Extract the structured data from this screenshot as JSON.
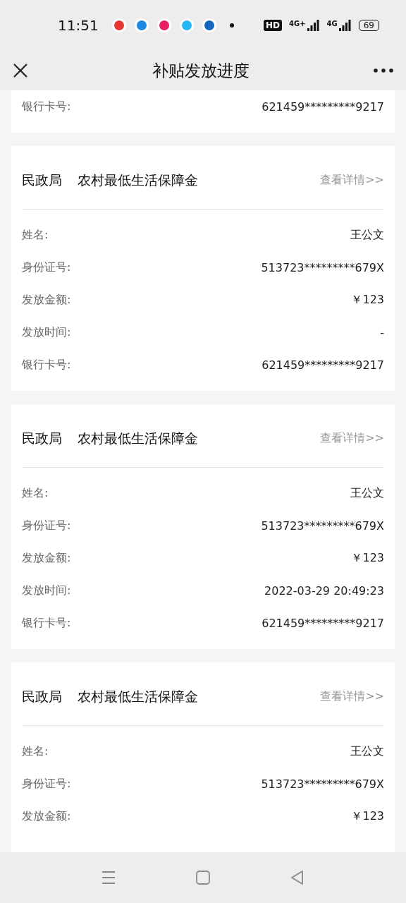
{
  "status_bar": {
    "time": "11:51",
    "hd": "HD",
    "networks": [
      "4G+",
      "4G"
    ],
    "battery": "69"
  },
  "header": {
    "title": "补贴发放进度"
  },
  "cards": [
    {
      "rows": [
        {
          "label": "银行卡号:",
          "value": "621459*********9217"
        }
      ]
    },
    {
      "department": "民政局",
      "program": "农村最低生活保障金",
      "link": "查看详情>>",
      "rows": [
        {
          "label": "姓名:",
          "value": "王公文"
        },
        {
          "label": "身份证号:",
          "value": "513723*********679X"
        },
        {
          "label": "发放金额:",
          "value": "￥123"
        },
        {
          "label": "发放时间:",
          "value": "-"
        },
        {
          "label": "银行卡号:",
          "value": "621459*********9217"
        }
      ]
    },
    {
      "department": "民政局",
      "program": "农村最低生活保障金",
      "link": "查看详情>>",
      "rows": [
        {
          "label": "姓名:",
          "value": "王公文"
        },
        {
          "label": "身份证号:",
          "value": "513723*********679X"
        },
        {
          "label": "发放金额:",
          "value": "￥123"
        },
        {
          "label": "发放时间:",
          "value": "2022-03-29 20:49:23"
        },
        {
          "label": "银行卡号:",
          "value": "621459*********9217"
        }
      ]
    },
    {
      "department": "民政局",
      "program": "农村最低生活保障金",
      "link": "查看详情>>",
      "rows": [
        {
          "label": "姓名:",
          "value": "王公文"
        },
        {
          "label": "身份证号:",
          "value": "513723*********679X"
        },
        {
          "label": "发放金额:",
          "value": "￥123"
        }
      ]
    }
  ]
}
